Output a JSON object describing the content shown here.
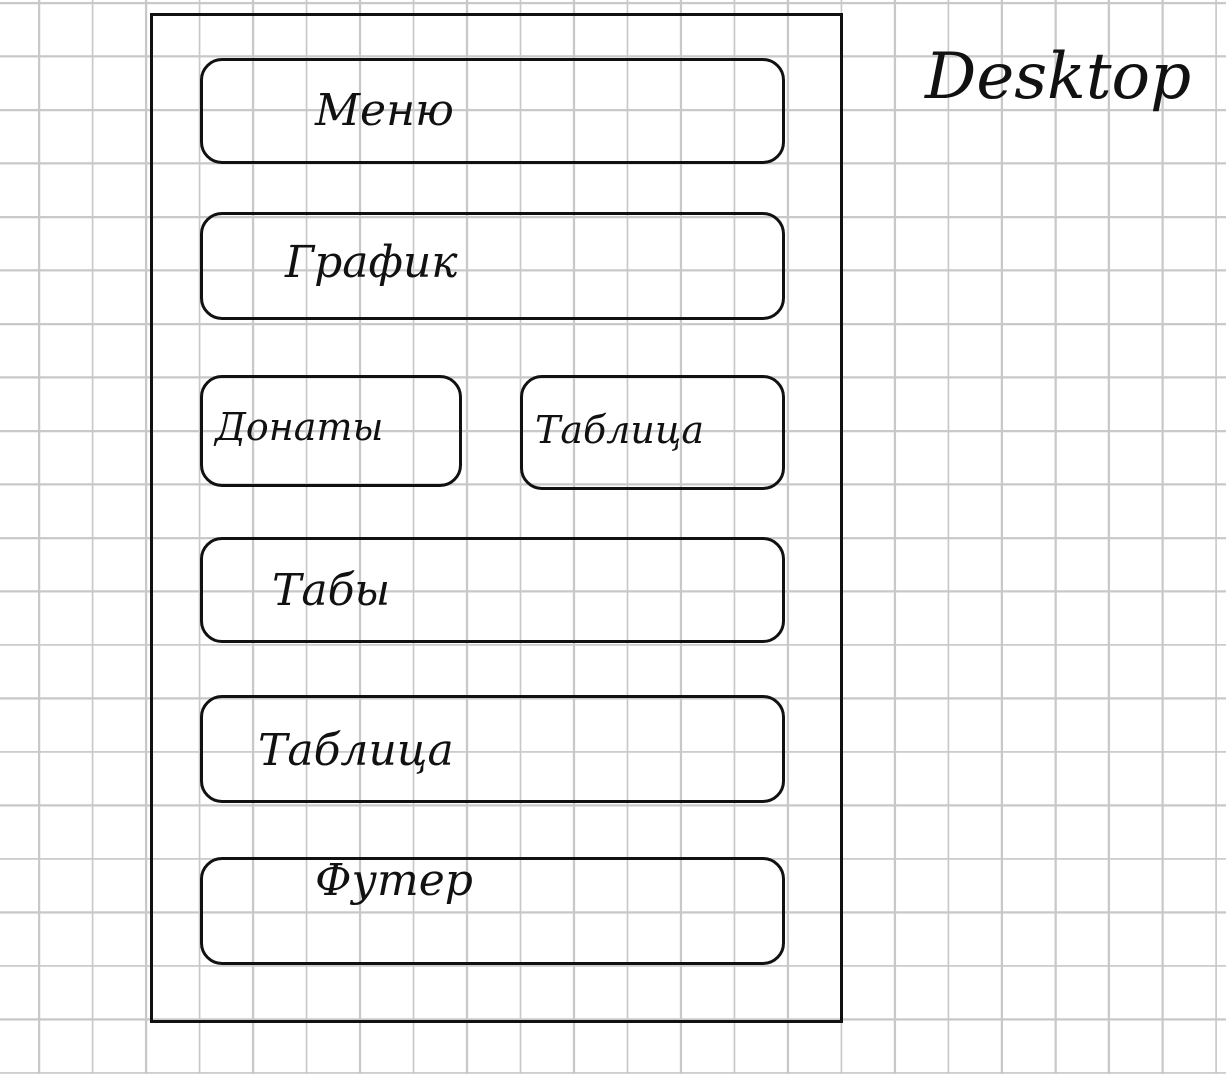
{
  "page_title": "Desktop",
  "blocks": {
    "menu": "Меню",
    "charts": "График",
    "donations": "Донаты",
    "table_small": "Таблица",
    "tabs": "Табы",
    "table": "Таблица",
    "footer": "Футер"
  }
}
